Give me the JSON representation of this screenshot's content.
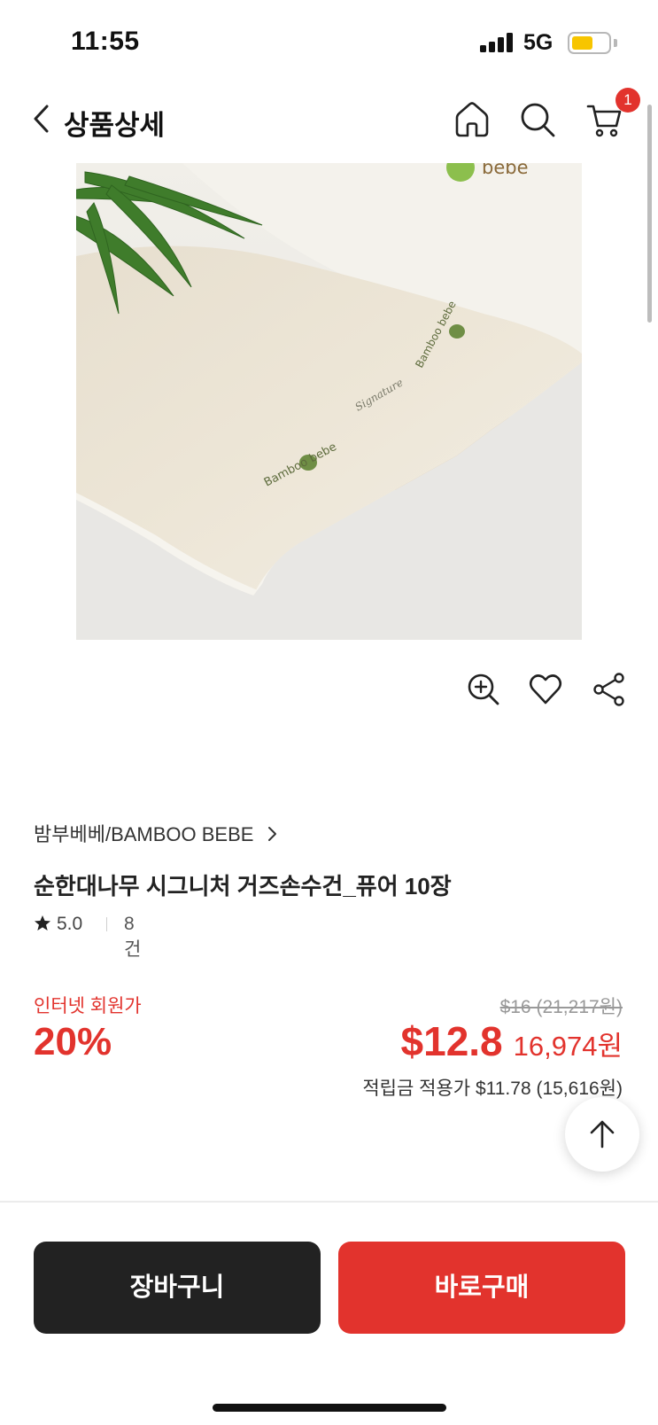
{
  "status_bar": {
    "time": "11:55",
    "network": "5G",
    "battery_color": "#f7c500"
  },
  "header": {
    "title": "상품상세",
    "cart_count": "1"
  },
  "product_image": {
    "logo_text": "bebe",
    "print_text": "Bamboo bebe",
    "script_text": "Signature"
  },
  "product": {
    "brand": "밤부베베/BAMBOO BEBE",
    "name": "순한대나무 시그니처 거즈손수건_퓨어 10장",
    "rating": "5.0",
    "review_count": "8건"
  },
  "pricing": {
    "member_label": "인터넷 회원가",
    "discount": "20%",
    "original_price": "$16 (21,217원)",
    "price_usd": "$12.8",
    "price_krw": "16,974원",
    "points": "적립금 적용가 $11.78 (15,616원)"
  },
  "actions": {
    "cart_label": "장바구니",
    "buy_label": "바로구매"
  },
  "colors": {
    "accent": "#e2332d",
    "dark_button": "#222222"
  }
}
